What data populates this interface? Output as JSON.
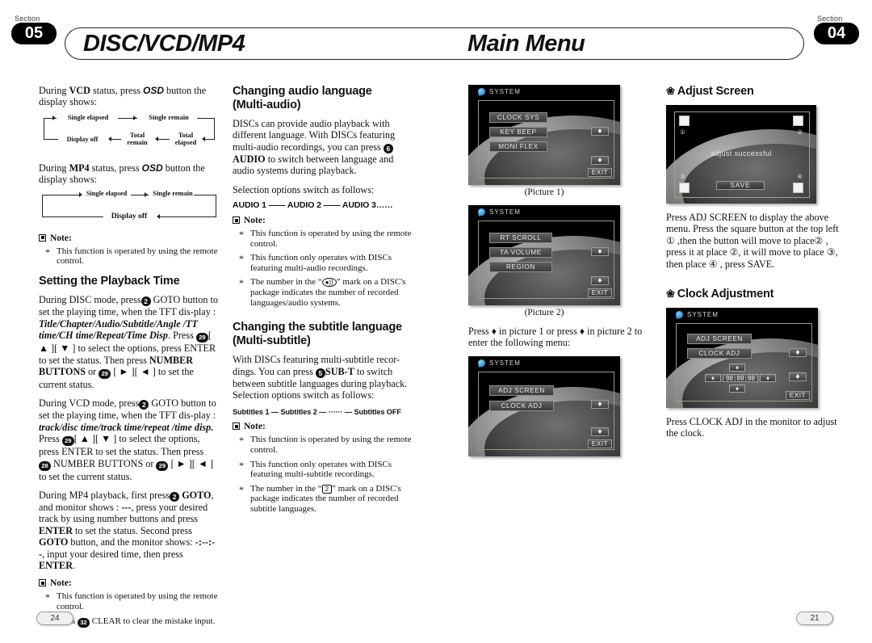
{
  "header": {
    "section_word_left": "Section",
    "section_num_left": "05",
    "title_left": "DISC/VCD/MP4",
    "title_right": "Main Menu",
    "section_word_right": "Section",
    "section_num_right": "04"
  },
  "col1": {
    "p1_a": "During ",
    "p1_vcd": "VCD",
    "p1_b": " status, press ",
    "p1_osd": "OSD",
    "p1_c": " button the display shows:",
    "flow1": {
      "single_elapsed": "Single elapsed",
      "single_remain": "Single remain",
      "total_elapsed": "Total elapsed",
      "total_remain": "Total remain",
      "display_off": "Display off"
    },
    "p2_a": "During ",
    "p2_mp4": "MP4",
    "p2_b": " status, press ",
    "p2_osd": "OSD",
    "p2_c": " button the display shows:",
    "flow2": {
      "single_elapsed": "Single elapsed",
      "single_remain": "Single remain",
      "display_off": "Display off"
    },
    "note_label": "Note:",
    "notes1": [
      "This function is operated by using the remote control."
    ],
    "heading_playback": "Setting the Playback Time",
    "disc_1": "During DISC mode, press",
    "disc_key": "2",
    "disc_2": " GOTO button to set the playing time, when the TFT dis-play : ",
    "disc_italic": "Title/Chapter/Audio/Subtitle/Angle /TT time/CH time/Repeat/Time Disp",
    "disc_3": ". Press ",
    "disc_key2": "29",
    "disc_4": "[ ▲ ][ ▼ ] to select the options, press ENTER to set the status. Then press ",
    "disc_bold1": "NUMBER BUTTONS",
    "disc_5": " or ",
    "disc_key3": "29",
    "disc_6": " [ ► ][ ◄ ] to set the current status.",
    "vcd_1": "During VCD mode, press",
    "vcd_key": "2",
    "vcd_2": " GOTO button to set the playing time, when the TFT dis-play : ",
    "vcd_italic": "track/disc time/track time/repeat /time disp.",
    "vcd_3": " Press ",
    "vcd_key2": "29",
    "vcd_4": "[ ▲ ][ ▼ ] to select the options, press ENTER to set the status. Then press ",
    "vcd_key3": "28",
    "vcd_5": " NUMBER BUTTONS or ",
    "vcd_key4": "29",
    "vcd_6": " [ ► ][ ◄ ] to set the current status.",
    "mp4_1": "During MP4 playback, first press",
    "mp4_key": "2",
    "mp4_2": " ",
    "mp4_bold1": "GOTO",
    "mp4_3": ", and monitor shows : ",
    "mp4_dash1": "---",
    "mp4_4": ", press your desired track by using number buttons and press ",
    "mp4_bold2": "ENTER",
    "mp4_5": " to set the status. Second press ",
    "mp4_bold3": "GOTO",
    "mp4_6": " button, and the monitor shows: ",
    "mp4_dash2": "-:--:--",
    "mp4_7": ", input your desired time, then press ",
    "mp4_bold4": "ENTER",
    "mp4_8": ".",
    "note_label2": "Note:",
    "notes2_1": "This function is operated by using the remote control.",
    "notes2_2a": "Press ",
    "notes2_key": "32",
    "notes2_2b": " CLEAR to clear the mistake input."
  },
  "col2": {
    "heading_audio_l1": "Changing audio language",
    "heading_audio_l2": "(Multi-audio)",
    "audio_p1": "DISCs can provide audio playback with different language. With DISCs featuring multi-audio recordings,  you can press ",
    "audio_key": "6",
    "audio_bold": "AUDIO",
    "audio_p2": " to switch between language and audio systems during playback.",
    "audio_sel": "Selection options switch as follows:",
    "audio_options": "AUDIO 1 —— AUDIO 2 —— AUDIO 3……",
    "note_label": "Note:",
    "audio_notes": [
      "This function is operated by using the remote control.",
      "This function only operates with DISCs featuring multi-audio recordings.",
      "The number in the “ ”  mark on a DISC's package indicates the number of recorded languages/audio systems."
    ],
    "audio_note3_a": "The number in the “",
    "audio_note3_mark": "●))",
    "audio_note3_b": "”  mark on a DISC's package indicates the number of recorded languages/audio systems.",
    "heading_sub_l1": "Changing the subtitle language",
    "heading_sub_l2": "(Multi-subtitle)",
    "sub_p1": "With DISCs featuring multi-subtitle recor-dings. You can press ",
    "sub_key": "5",
    "sub_bold": "SUB-T",
    "sub_p2": " to switch between subtitle languages during playback. Selection options switch as follows:",
    "sub_options": "Subtitles 1 — Subtitles 2 — ······ — Subtitles OFF",
    "note_label2": "Note:",
    "sub_notes": [
      "This function is operated by using the remote control.",
      "This function only operates with DISCs featuring multi-subtitle recordings."
    ],
    "sub_note3_a": "The number in the “",
    "sub_note3_mark": "2",
    "sub_note3_b": "”  mark on a DISC's package indicates the number of recorded subtitle languages."
  },
  "col3": {
    "pic1": {
      "sys_label": "SYSTEM",
      "items": [
        "CLOCK SYS",
        "KEY BEEP",
        "MONI FLEX"
      ],
      "exit": "EXIT",
      "arrow_up": "♦",
      "arrow_down": "♦"
    },
    "caption1": "(Picture 1)",
    "pic2": {
      "sys_label": "SYSTEM",
      "items": [
        "RT SCROLL",
        "TA VOLUME",
        "REGION"
      ],
      "exit": "EXIT",
      "arrow_up": "♦",
      "arrow_down": "♦"
    },
    "caption2": "(Picture 2)",
    "press_text": "Press  ♦  in picture 1 or press  ♦  in picture 2 to enter the following menu:",
    "pic3": {
      "sys_label": "SYSTEM",
      "items": [
        "ADJ SCREEN",
        "CLOCK ADJ"
      ],
      "exit": "EXIT"
    }
  },
  "col4": {
    "heading_adjust": "Adjust Screen",
    "adjust_shot": {
      "msg": "adjust successful",
      "save": "SAVE",
      "n1": "①",
      "n2": "②",
      "n3": "③",
      "n4": "④"
    },
    "adjust_text": "Press ADJ SCREEN to display the above menu. Press the square button at the top left ① ,then the button will move to place② , press it at place ②, it will move to place ③, then place ④ , press SAVE.",
    "heading_clock": "Clock Adjustment",
    "clock_shot": {
      "sys_label": "SYSTEM",
      "items": [
        "ADJ SCREEN",
        "CLOCK ADJ"
      ],
      "time_value": "00:00:00",
      "exit": "EXIT"
    },
    "clock_text": "Press CLOCK ADJ in the monitor to adjust the clock."
  },
  "footer": {
    "page_left": "24",
    "page_right": "21"
  }
}
